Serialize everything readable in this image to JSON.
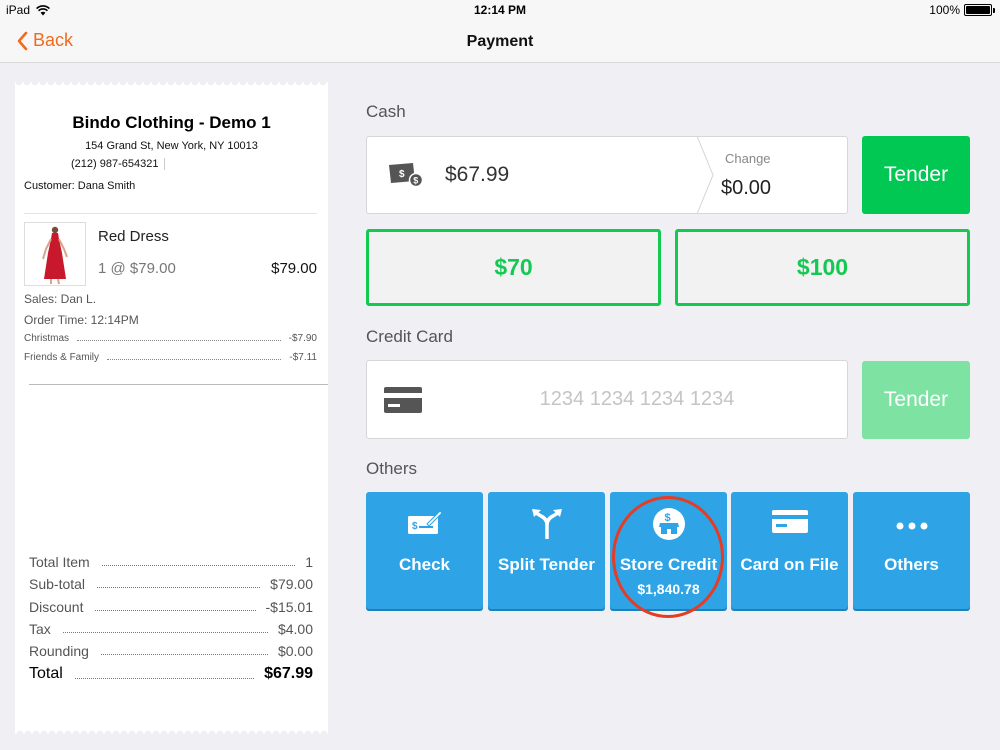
{
  "status_bar": {
    "device": "iPad",
    "time": "12:14 PM",
    "battery": "100%"
  },
  "nav": {
    "back_label": "Back",
    "title": "Payment"
  },
  "receipt": {
    "store_name": "Bindo Clothing - Demo 1",
    "address": "154 Grand St, New York, NY 10013",
    "phone": "(212) 987-654321",
    "customer": "Customer: Dana Smith",
    "item": {
      "name": "Red Dress",
      "qty_price": "1 @ $79.00",
      "total": "$79.00"
    },
    "sales": "Sales: Dan L.",
    "order_time": "Order Time: 12:14PM",
    "discounts": [
      {
        "label": "Christmas",
        "value": "-$7.90"
      },
      {
        "label": "Friends & Family",
        "value": "-$7.11"
      }
    ],
    "totals": [
      {
        "label": "Total Item",
        "value": "1"
      },
      {
        "label": "Sub-total",
        "value": "$79.00"
      },
      {
        "label": "Discount",
        "value": "-$15.01"
      },
      {
        "label": "Tax",
        "value": "$4.00"
      },
      {
        "label": "Rounding",
        "value": "$0.00"
      }
    ],
    "grand_total": {
      "label": "Total",
      "value": "$67.99"
    }
  },
  "cash": {
    "section_label": "Cash",
    "amount": "$67.99",
    "change_label": "Change",
    "change_value": "$0.00",
    "tender_label": "Tender",
    "quick_amounts": [
      "$70",
      "$100"
    ]
  },
  "credit_card": {
    "section_label": "Credit Card",
    "placeholder": "1234 1234 1234 1234",
    "tender_label": "Tender"
  },
  "others": {
    "section_label": "Others",
    "tiles": [
      {
        "label": "Check"
      },
      {
        "label": "Split Tender"
      },
      {
        "label": "Store Credit",
        "sub": "$1,840.78"
      },
      {
        "label": "Card on File"
      },
      {
        "label": "Others"
      }
    ]
  },
  "colors": {
    "accent_orange": "#f26b1d",
    "green": "#00c853",
    "blue": "#2ea3e6",
    "highlight_red": "#e53c24"
  }
}
